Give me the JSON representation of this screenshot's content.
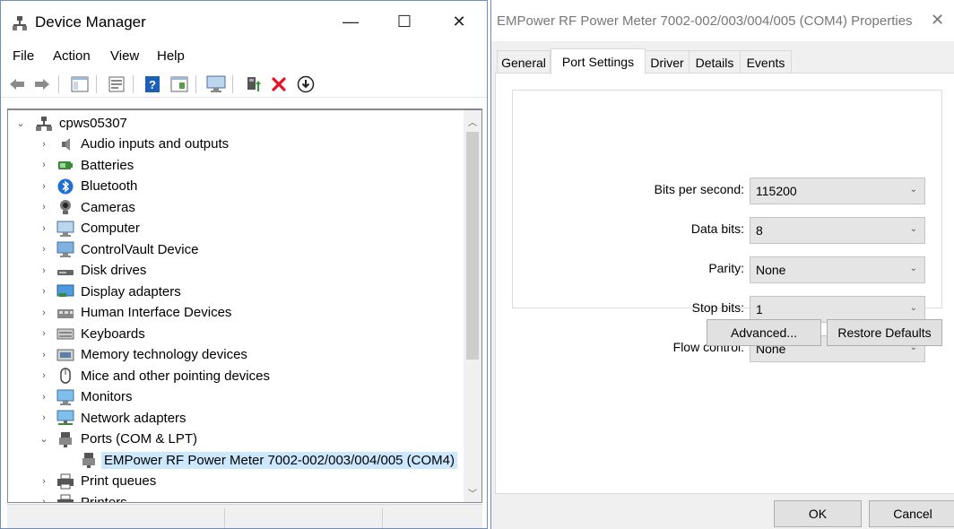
{
  "device_manager": {
    "title": "Device Manager",
    "window_controls": {
      "minimize": "—",
      "maximize": "☐",
      "close": "✕"
    },
    "menu": [
      "File",
      "Action",
      "View",
      "Help"
    ],
    "toolbar_icons": [
      "back-arrow-icon",
      "forward-arrow-icon",
      "show-hide-tree-icon",
      "properties-icon",
      "help-icon",
      "view-icon",
      "monitor-scan-icon",
      "update-driver-icon",
      "uninstall-icon",
      "download-icon"
    ],
    "tree": {
      "root": "cpws05307",
      "items": [
        {
          "label": "Audio inputs and outputs",
          "icon": "speaker-icon"
        },
        {
          "label": "Batteries",
          "icon": "battery-icon"
        },
        {
          "label": "Bluetooth",
          "icon": "bluetooth-icon"
        },
        {
          "label": "Cameras",
          "icon": "camera-icon"
        },
        {
          "label": "Computer",
          "icon": "computer-icon"
        },
        {
          "label": "ControlVault Device",
          "icon": "controlvault-icon"
        },
        {
          "label": "Disk drives",
          "icon": "disk-drive-icon"
        },
        {
          "label": "Display adapters",
          "icon": "display-adapter-icon"
        },
        {
          "label": "Human Interface Devices",
          "icon": "hid-icon"
        },
        {
          "label": "Keyboards",
          "icon": "keyboard-icon"
        },
        {
          "label": "Memory technology devices",
          "icon": "memory-icon"
        },
        {
          "label": "Mice and other pointing devices",
          "icon": "mouse-icon"
        },
        {
          "label": "Monitors",
          "icon": "monitor-icon"
        },
        {
          "label": "Network adapters",
          "icon": "network-adapter-icon"
        },
        {
          "label": "Ports (COM & LPT)",
          "icon": "port-icon"
        },
        {
          "label": "EMPower RF Power Meter 7002-002/003/004/005 (COM4)",
          "icon": "port-device-icon"
        },
        {
          "label": "Print queues",
          "icon": "printer-icon"
        },
        {
          "label": "Printers",
          "icon": "printer-icon"
        }
      ]
    }
  },
  "properties": {
    "title": "EMPower RF Power Meter 7002-002/003/004/005 (COM4) Properties",
    "close_glyph": "✕",
    "tabs": [
      "General",
      "Port Settings",
      "Driver",
      "Details",
      "Events"
    ],
    "active_tab": "Port Settings",
    "fields": [
      {
        "label": "Bits per second:",
        "value": "115200"
      },
      {
        "label": "Data bits:",
        "value": "8"
      },
      {
        "label": "Parity:",
        "value": "None"
      },
      {
        "label": "Stop bits:",
        "value": "1"
      },
      {
        "label": "Flow control:",
        "value": "None"
      }
    ],
    "buttons": {
      "advanced": "Advanced...",
      "restore": "Restore Defaults",
      "ok": "OK",
      "cancel": "Cancel"
    }
  },
  "glyphs": {
    "chevron_right": "›",
    "chevron_down": "⌄",
    "combo_arrow": "⌄",
    "scroll_up": "︿",
    "scroll_down": "﹀"
  },
  "colors": {
    "selection": "#cce8ff",
    "window_border": "#6a8fc8",
    "uninstall_red": "#e81123",
    "help_blue": "#1c5fb8"
  }
}
